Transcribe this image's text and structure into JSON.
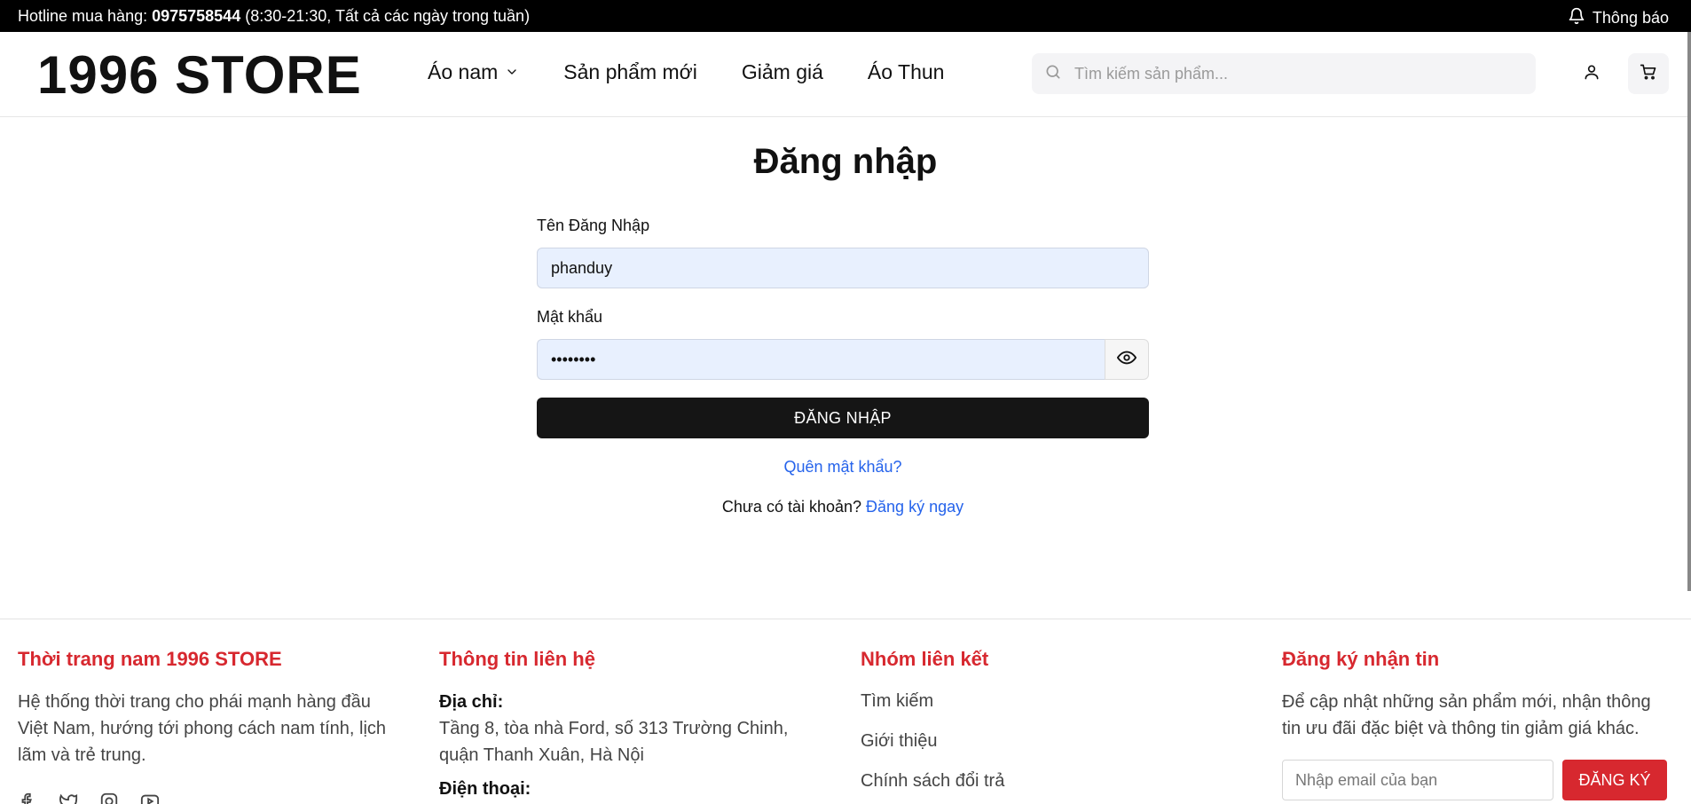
{
  "topbar": {
    "hotline_prefix": "Hotline mua hàng: ",
    "hotline_number": "0975758544",
    "hotline_hours": " (8:30-21:30, Tất cả các ngày trong tuần)",
    "notify_label": "Thông báo"
  },
  "header": {
    "logo": "1996 STORE",
    "nav": [
      {
        "label": "Áo nam",
        "has_dropdown": true
      },
      {
        "label": "Sản phẩm mới"
      },
      {
        "label": "Giảm giá"
      },
      {
        "label": "Áo Thun"
      }
    ],
    "search_placeholder": "Tìm kiếm sản phẩm..."
  },
  "login": {
    "title": "Đăng nhập",
    "username_label": "Tên Đăng Nhập",
    "username_value": "phanduy",
    "password_label": "Mật khẩu",
    "password_value": "••••••••",
    "submit_label": "ĐĂNG NHẬP",
    "forgot_label": "Quên mật khẩu?",
    "no_account_text": "Chưa có tài khoản? ",
    "signup_link": "Đăng ký ngay"
  },
  "footer": {
    "col1": {
      "title": "Thời trang nam 1996 STORE",
      "text": "Hệ thống thời trang cho phái mạnh hàng đầu Việt Nam, hướng tới phong cách nam tính, lịch lãm và trẻ trung."
    },
    "col2": {
      "title": "Thông tin liên hệ",
      "address_label": "Địa chỉ:",
      "address": "Tầng 8, tòa nhà Ford, số 313 Trường Chinh, quận Thanh Xuân, Hà Nội",
      "phone_label": "Điện thoại:"
    },
    "col3": {
      "title": "Nhóm liên kết",
      "links": [
        "Tìm kiếm",
        "Giới thiệu",
        "Chính sách đổi trả"
      ]
    },
    "col4": {
      "title": "Đăng ký nhận tin",
      "text": "Để cập nhật những sản phẩm mới, nhận thông tin ưu đãi đặc biệt và thông tin giảm giá khác.",
      "email_placeholder": "Nhập email của bạn",
      "button_label": "ĐĂNG KÝ"
    }
  },
  "colors": {
    "accent_red": "#d7282f",
    "link_blue": "#2563eb",
    "button_dark": "#151515",
    "input_fill": "#e8f0fe"
  }
}
